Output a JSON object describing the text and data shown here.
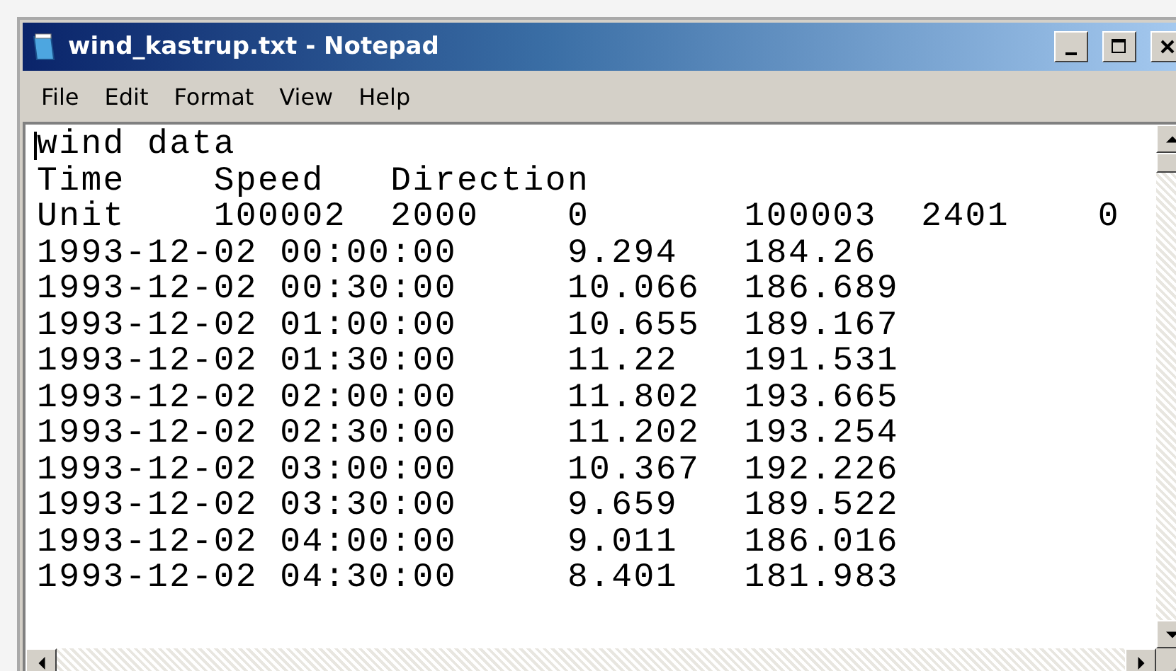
{
  "window": {
    "title": "wind_kastrup.txt - Notepad"
  },
  "menu": [
    "File",
    "Edit",
    "Format",
    "View",
    "Help"
  ],
  "editor": {
    "lines": [
      "wind data",
      "Time    Speed   Direction",
      "Unit    100002  2000    0       100003  2401    0",
      "1993-12-02 00:00:00     9.294   184.26",
      "1993-12-02 00:30:00     10.066  186.689",
      "1993-12-02 01:00:00     10.655  189.167",
      "1993-12-02 01:30:00     11.22   191.531",
      "1993-12-02 02:00:00     11.802  193.665",
      "1993-12-02 02:30:00     11.202  193.254",
      "1993-12-02 03:00:00     10.367  192.226",
      "1993-12-02 03:30:00     9.659   189.522",
      "1993-12-02 04:00:00     9.011   186.016",
      "1993-12-02 04:30:00     8.401   181.983"
    ]
  }
}
